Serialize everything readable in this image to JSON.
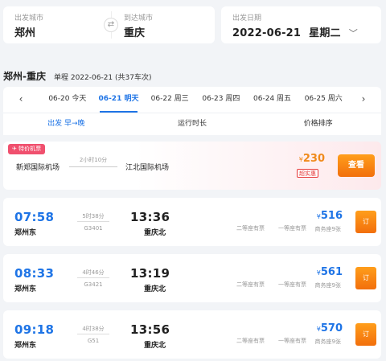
{
  "search": {
    "from_label": "出发城市",
    "from_city": "郑州",
    "to_label": "到达城市",
    "to_city": "重庆",
    "swap_icon": "⇄",
    "date_label": "出发日期",
    "date_value": "2022-06-21",
    "weekday": "星期二",
    "dropdown_icon": "﹀"
  },
  "route": {
    "title": "郑州-重庆",
    "subtitle": "单程 2022-06-21 (共37车次)"
  },
  "date_tabs": {
    "prev_icon": "‹",
    "next_icon": "›",
    "items": [
      {
        "label": "06-20 今天"
      },
      {
        "label": "06-21 明天"
      },
      {
        "label": "06-22 周三"
      },
      {
        "label": "06-23 周四"
      },
      {
        "label": "06-24 周五"
      },
      {
        "label": "06-25 周六"
      }
    ],
    "active_index": 1
  },
  "sort": {
    "depart_label": "出发 早",
    "depart_arrow": "→",
    "depart_suffix": "晚",
    "duration_label": "运行时长",
    "price_label": "价格排序"
  },
  "flight_promo": {
    "badge": "特价机票",
    "badge_icon": "✈",
    "from_airport": "新郑国际机场",
    "duration": "2小时10分",
    "to_airport": "江北国际机场",
    "currency": "¥",
    "price": "230",
    "tag": "超实惠",
    "button": "查看"
  },
  "trains": [
    {
      "depart_time": "07:58",
      "from_station": "郑州东",
      "duration": "5时38分",
      "train_no": "G3401",
      "arrive_time": "13:36",
      "to_station": "重庆北",
      "seat_2nd": "二等座有票",
      "seat_1st": "一等座有票",
      "currency": "¥",
      "price": "516",
      "seat_biz": "商务座9张",
      "button": "订"
    },
    {
      "depart_time": "08:33",
      "from_station": "郑州东",
      "duration": "4时46分",
      "train_no": "G3421",
      "arrive_time": "13:19",
      "to_station": "重庆北",
      "seat_2nd": "二等座有票",
      "seat_1st": "一等座有票",
      "currency": "¥",
      "price": "561",
      "seat_biz": "商务座9张",
      "button": "订"
    },
    {
      "depart_time": "09:18",
      "from_station": "郑州东",
      "duration": "4时38分",
      "train_no": "G51",
      "arrive_time": "13:56",
      "to_station": "重庆北",
      "seat_2nd": "二等座有票",
      "seat_1st": "一等座有票",
      "currency": "¥",
      "price": "570",
      "seat_biz": "商务座9张",
      "button": "订"
    }
  ],
  "colors": {
    "accent": "#1e74e6",
    "orange": "#f08a1b",
    "promo_badge": "#f0506e"
  }
}
